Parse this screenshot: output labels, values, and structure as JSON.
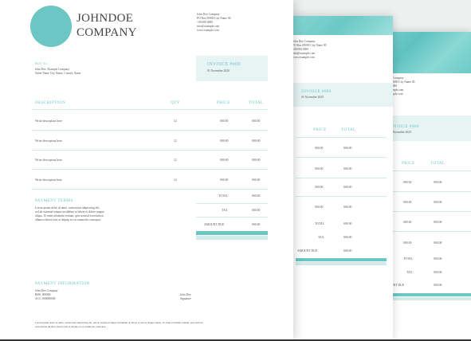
{
  "company": {
    "name_line1": "JOHNDOE",
    "name_line2": "COMPANY",
    "address": [
      "John Doe Company",
      "PO Box 00000 City Name 00",
      "+00 000 0000",
      "info@example.com",
      "www.example.com"
    ]
  },
  "bill_to": {
    "label": "Bill To",
    "lines": [
      "John Doe, Example Company",
      "Street Name City Name, Country Name"
    ]
  },
  "invoice": {
    "title": "INVOICE #000",
    "date": "01 November 2020"
  },
  "table": {
    "headers": [
      "DESCRIPTION",
      "QTY",
      "PRICE",
      "TOTAL"
    ],
    "rows": [
      {
        "desc": "Write description here",
        "qty": "12",
        "price": "000.00",
        "total": "000.00"
      },
      {
        "desc": "Write description here",
        "qty": "12",
        "price": "000.00",
        "total": "000.00"
      },
      {
        "desc": "Write description here",
        "qty": "12",
        "price": "000.00",
        "total": "000.00"
      },
      {
        "desc": "Write description here",
        "qty": "12",
        "price": "000.00",
        "total": "000.00"
      }
    ]
  },
  "totals": {
    "total_label": "TOTAL",
    "total_value": "000.00",
    "tax_label": "TAX",
    "tax_value": "000.00",
    "due_label": "AMOUNT DUE",
    "due_value": "000.00"
  },
  "payment_terms": {
    "label": "PAYMENT TERMS",
    "lines": [
      "Lorem ipsum dolor sit amet, consectetur adipisicing elit,",
      "sed do eiusmod tempor incididunt ut labore et dolore magna",
      "aliqua. Ut enim ad minim veniam, quis nostrud exercitation",
      "ullamco laboris nisi ut aliquip ex ea commodo consequat."
    ]
  },
  "payment_info": {
    "label": "PAYMENT INFORMATION",
    "lines": [
      "John Doe Company",
      "BSB: 000000",
      "ACC: 000000000"
    ],
    "signer": "John Doe",
    "signature_label": "Signature"
  },
  "footer": {
    "lines": [
      "Lorem ipsum dolor sit amet, consectetur adipisicing elit, sed do eiusmod tempor incididunt ut labore et dolore magna aliqua. Ut enim ad minim veniam, quis nostrud",
      "exercitation ullamco laboris nisi ut aliquip ex ea commodo consequat."
    ]
  },
  "colors": {
    "accent": "#6cc6c4",
    "light_band": "#e6f4f4"
  }
}
